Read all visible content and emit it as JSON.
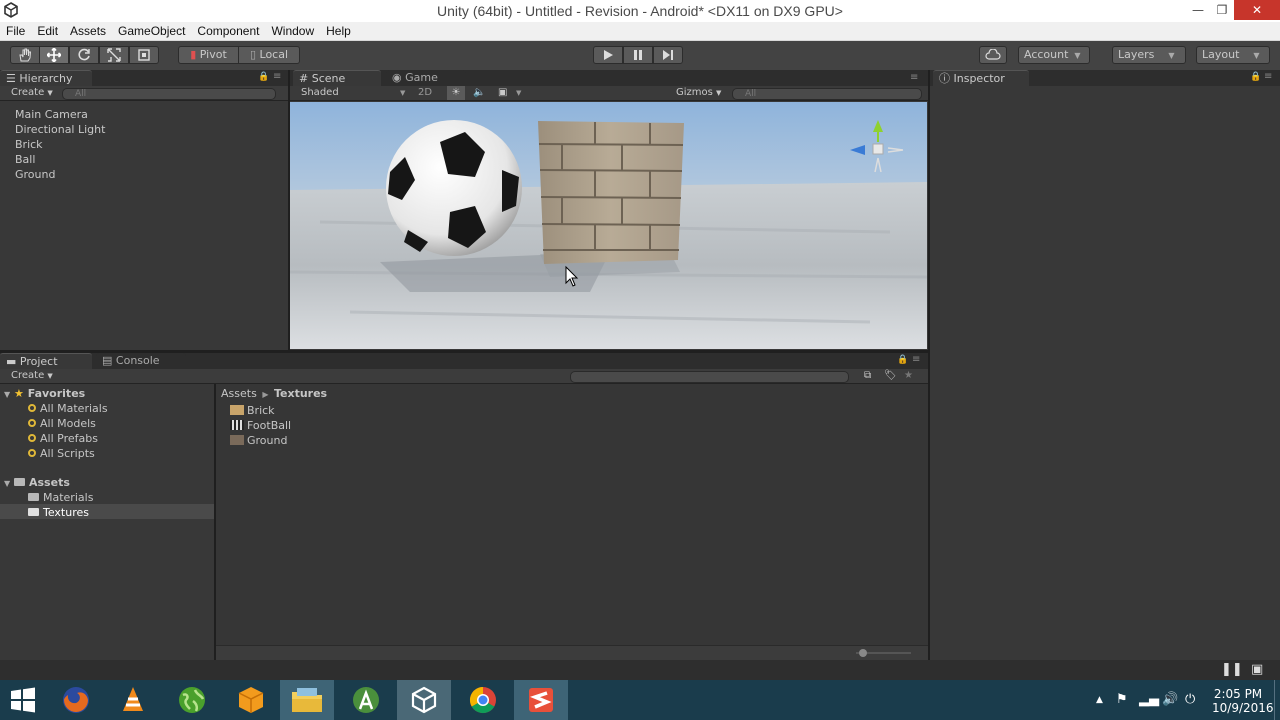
{
  "window": {
    "title": "Unity (64bit) - Untitled - Revision - Android* <DX11 on DX9 GPU>",
    "minimize": "—",
    "restore": "❐",
    "close": "✕"
  },
  "menu": [
    "File",
    "Edit",
    "Assets",
    "GameObject",
    "Component",
    "Window",
    "Help"
  ],
  "toolbar": {
    "tools": [
      "hand-tool-icon",
      "move-tool-icon",
      "rotate-tool-icon",
      "scale-tool-icon",
      "rect-tool-icon"
    ],
    "pivot_label": "Pivot",
    "local_label": "Local",
    "account_label": "Account",
    "layers_label": "Layers",
    "layout_label": "Layout"
  },
  "hierarchy": {
    "tab_label": "Hierarchy",
    "create_label": "Create",
    "search_placeholder": "All",
    "items": [
      "Main Camera",
      "Directional Light",
      "Brick",
      "Ball",
      "Ground"
    ]
  },
  "scene": {
    "tab_scene": "Scene",
    "tab_game": "Game",
    "shading_mode": "Shaded",
    "mode_2d": "2D",
    "gizmos_label": "Gizmos",
    "search_placeholder": "All"
  },
  "inspector": {
    "tab_label": "Inspector"
  },
  "project": {
    "tab_project": "Project",
    "tab_console": "Console",
    "create_label": "Create",
    "favorites_label": "Favorites",
    "favorites": [
      "All Materials",
      "All Models",
      "All Prefabs",
      "All Scripts"
    ],
    "assets_label": "Assets",
    "folders": [
      "Materials",
      "Textures"
    ],
    "selected_folder": "Textures",
    "breadcrumb": [
      "Assets",
      "Textures"
    ],
    "files": [
      {
        "name": "Brick",
        "thumb_color": "#c8a46a"
      },
      {
        "name": "FootBall",
        "thumb_color": "#dddddd"
      },
      {
        "name": "Ground",
        "thumb_color": "#7a6a5a"
      }
    ]
  },
  "taskbar": {
    "apps": [
      "windows-start-icon",
      "firefox-icon",
      "vlc-icon",
      "globe-icon",
      "package-icon",
      "file-explorer-icon",
      "android-studio-icon",
      "unity-icon",
      "chrome-icon",
      "sublime-text-icon"
    ],
    "active_app": "unity-icon",
    "time": "2:05 PM",
    "date": "10/9/2016"
  },
  "colors": {
    "titlebar_close": "#c7352b",
    "taskbar_bg": "#1a3c4c",
    "editor_bg": "#383838",
    "favorites_star": "#f2c232"
  }
}
